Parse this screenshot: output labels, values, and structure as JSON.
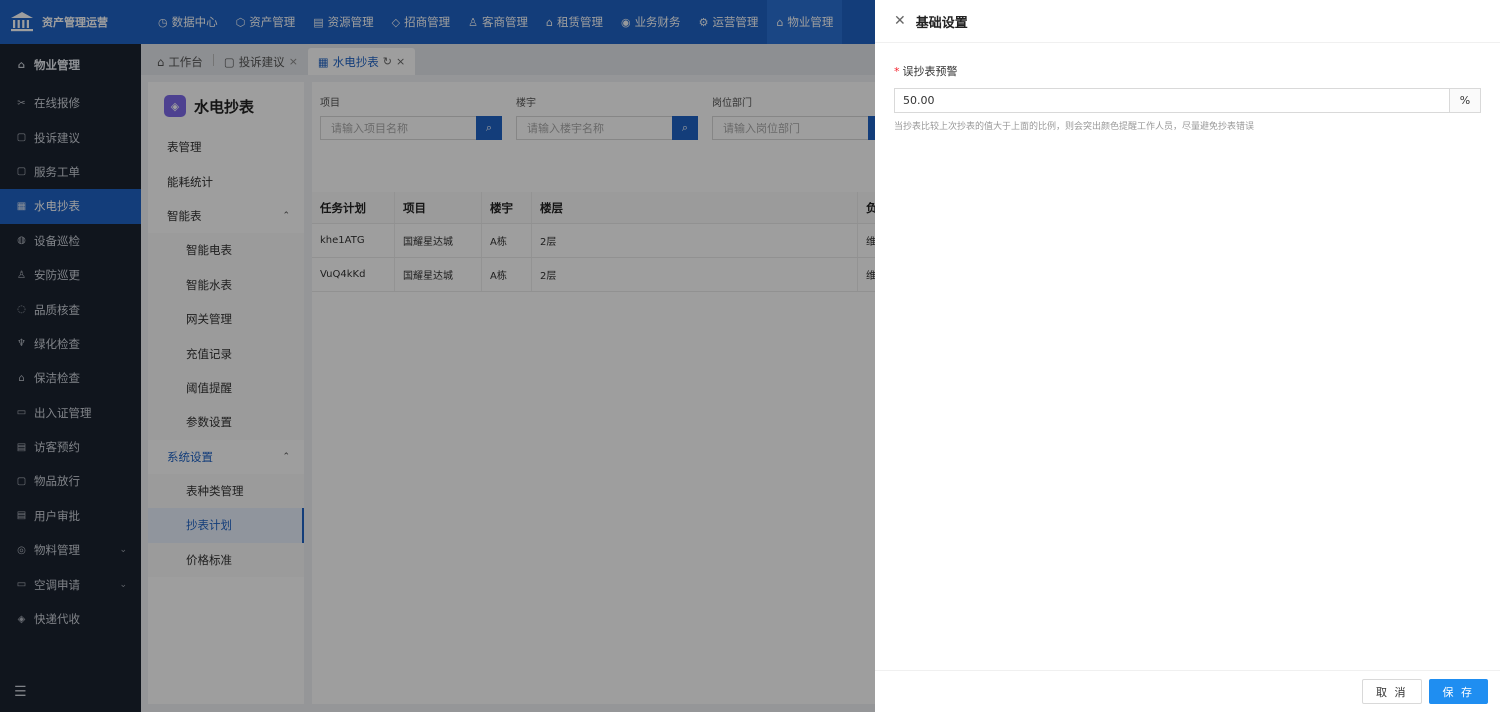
{
  "brand": {
    "name": "资产管理运营"
  },
  "topnav": [
    {
      "icon": "◷",
      "label": "数据中心"
    },
    {
      "icon": "⬡",
      "label": "资产管理"
    },
    {
      "icon": "▤",
      "label": "资源管理"
    },
    {
      "icon": "◇",
      "label": "招商管理"
    },
    {
      "icon": "♙",
      "label": "客商管理"
    },
    {
      "icon": "⌂",
      "label": "租赁管理"
    },
    {
      "icon": "◉",
      "label": "业务财务"
    },
    {
      "icon": "⚙",
      "label": "运营管理"
    },
    {
      "icon": "⌂",
      "label": "物业管理"
    }
  ],
  "sidebar": {
    "header": {
      "icon": "⌂",
      "label": "物业管理"
    },
    "items": [
      {
        "icon": "✂",
        "label": "在线报修"
      },
      {
        "icon": "▢",
        "label": "投诉建议"
      },
      {
        "icon": "▢",
        "label": "服务工单"
      },
      {
        "icon": "▦",
        "label": "水电抄表"
      },
      {
        "icon": "◍",
        "label": "设备巡检"
      },
      {
        "icon": "♙",
        "label": "安防巡更"
      },
      {
        "icon": "◌",
        "label": "品质核查"
      },
      {
        "icon": "♆",
        "label": "绿化检查"
      },
      {
        "icon": "⌂",
        "label": "保洁检查"
      },
      {
        "icon": "▭",
        "label": "出入证管理"
      },
      {
        "icon": "▤",
        "label": "访客预约"
      },
      {
        "icon": "▢",
        "label": "物品放行"
      },
      {
        "icon": "▤",
        "label": "用户审批"
      },
      {
        "icon": "◎",
        "label": "物料管理"
      },
      {
        "icon": "▭",
        "label": "空调申请"
      },
      {
        "icon": "◈",
        "label": "快递代收"
      }
    ],
    "collapse_icon": "☰"
  },
  "tabs": [
    {
      "icon": "⌂",
      "label": "工作台",
      "close": ""
    },
    {
      "icon": "▢",
      "label": "投诉建议",
      "close": "×"
    },
    {
      "icon": "▦",
      "label": "水电抄表",
      "close": "×",
      "refresh": "↻"
    }
  ],
  "submenu": {
    "title": "水电抄表",
    "logo": "◈",
    "items": [
      {
        "label": "表管理"
      },
      {
        "label": "能耗统计"
      },
      {
        "label": "智能表",
        "chevron": "⌃"
      },
      {
        "label": "智能电表"
      },
      {
        "label": "智能水表"
      },
      {
        "label": "网关管理"
      },
      {
        "label": "充值记录"
      },
      {
        "label": "阈值提醒"
      },
      {
        "label": "参数设置"
      },
      {
        "label": "系统设置",
        "chevron": "⌃"
      },
      {
        "label": "表种类管理"
      },
      {
        "label": "抄表计划"
      },
      {
        "label": "价格标准"
      }
    ]
  },
  "filters": [
    {
      "label": "项目",
      "placeholder": "请输入项目名称",
      "btn_icon": "⌕"
    },
    {
      "label": "楼宇",
      "placeholder": "请输入楼宇名称",
      "btn_icon": "⌕"
    },
    {
      "label": "岗位部门",
      "placeholder": "请输入岗位部门",
      "btn_icon": "⌕"
    }
  ],
  "table": {
    "columns": [
      "任务计划",
      "项目",
      "楼宇",
      "楼层",
      "负"
    ],
    "rows": [
      [
        "khe1ATG",
        "国耀星达城",
        "A栋",
        "2层",
        "维"
      ],
      [
        "VuQ4kKd",
        "国耀星达城",
        "A栋",
        "2层",
        "维"
      ]
    ]
  },
  "drawer": {
    "close_icon": "✕",
    "title": "基础设置",
    "field": {
      "required_mark": "*",
      "label": "误抄表预警",
      "value": "50.00",
      "suffix": "%",
      "help": "当抄表比较上次抄表的值大于上面的比例，则会突出颜色提醒工作人员，尽量避免抄表错误"
    },
    "cancel_label": "取 消",
    "save_label": "保 存"
  }
}
